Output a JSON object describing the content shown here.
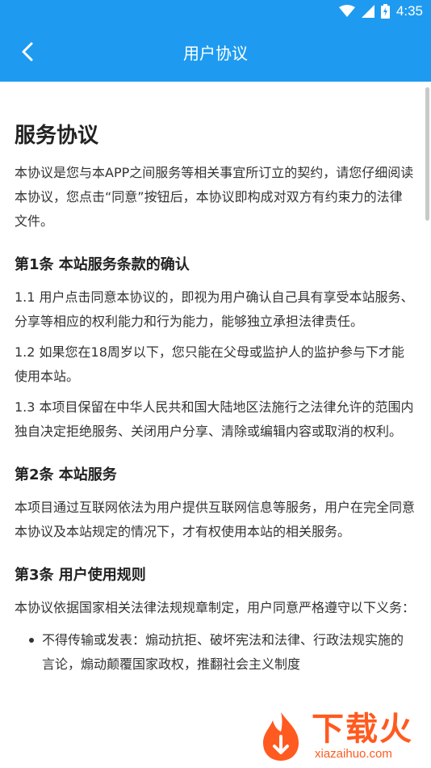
{
  "status_bar": {
    "time": "4:35"
  },
  "app_bar": {
    "title": "用户协议"
  },
  "doc": {
    "title": "服务协议",
    "intro": "本协议是您与本APP之间服务等相关事宜所订立的契约，请您仔细阅读本协议，您点击“同意”按钮后，本协议即构成对双方有约束力的法律文件。",
    "sections": [
      {
        "heading": "第1条 本站服务条款的确认",
        "clauses": [
          "1.1 用户点击同意本协议的，即视为用户确认自己具有享受本站服务、分享等相应的权利能力和行为能力，能够独立承担法律责任。",
          "1.2 如果您在18周岁以下，您只能在父母或监护人的监护参与下才能使用本站。",
          "1.3 本项目保留在中华人民共和国大陆地区法施行之法律允许的范围内独自决定拒绝服务、关闭用户分享、清除或编辑内容或取消的权利。"
        ]
      },
      {
        "heading": "第2条 本站服务",
        "clauses": [
          "本项目通过互联网依法为用户提供互联网信息等服务，用户在完全同意本协议及本站规定的情况下，才有权使用本站的相关服务。"
        ]
      },
      {
        "heading": "第3条 用户使用规则",
        "clauses": [
          "本协议依据国家相关法律法规规章制定，用户同意严格遵守以下义务："
        ],
        "bullets": [
          "不得传输或发表：煽动抗拒、破坏宪法和法律、行政法规实施的言论，煽动颠覆国家政权，推翻社会主义制度"
        ]
      }
    ]
  },
  "watermark": {
    "cn": "下载火",
    "en": "xiazaihuo.com"
  },
  "colors": {
    "primary": "#1e9bf0",
    "watermark": "#ff5a1f"
  }
}
